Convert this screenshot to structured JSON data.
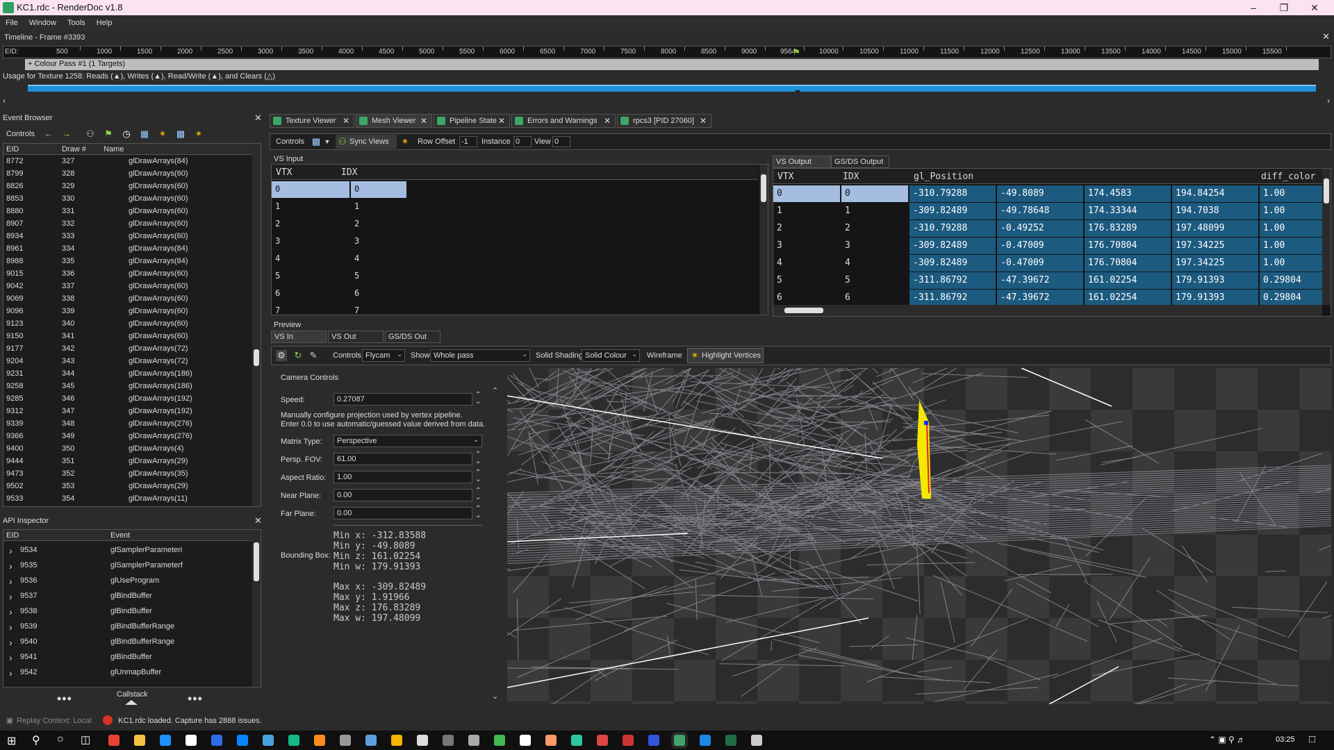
{
  "window": {
    "title": "KC1.rdc - RenderDoc v1.8"
  },
  "menu": [
    "File",
    "Window",
    "Tools",
    "Help"
  ],
  "timeline": {
    "title": "Timeline - Frame #3393",
    "eid_label": "EID:",
    "ticks": [
      "500",
      "1000",
      "1500",
      "2000",
      "2500",
      "3000",
      "3500",
      "4000",
      "4500",
      "5000",
      "5500",
      "6000",
      "6500",
      "7000",
      "7500",
      "8000",
      "8500",
      "9000",
      "9564",
      "10000",
      "10500",
      "11000",
      "11500",
      "12000",
      "12500",
      "13000",
      "13500",
      "14000",
      "14500",
      "15000",
      "15500"
    ],
    "colour_pass": "+ Colour Pass #1 (1 Targets)",
    "usage": "Usage for Texture 1258: Reads (▲), Writes (▲), Read/Write (▲), and Clears (△)"
  },
  "event_browser": {
    "title": "Event Browser",
    "controls_label": "Controls",
    "columns": [
      "EID",
      "Draw #",
      "Name"
    ],
    "rows": [
      [
        "8772",
        "327",
        "glDrawArrays(84)"
      ],
      [
        "8799",
        "328",
        "glDrawArrays(60)"
      ],
      [
        "8826",
        "329",
        "glDrawArrays(60)"
      ],
      [
        "8853",
        "330",
        "glDrawArrays(60)"
      ],
      [
        "8880",
        "331",
        "glDrawArrays(60)"
      ],
      [
        "8907",
        "332",
        "glDrawArrays(60)"
      ],
      [
        "8934",
        "333",
        "glDrawArrays(60)"
      ],
      [
        "8961",
        "334",
        "glDrawArrays(84)"
      ],
      [
        "8988",
        "335",
        "glDrawArrays(84)"
      ],
      [
        "9015",
        "336",
        "glDrawArrays(60)"
      ],
      [
        "9042",
        "337",
        "glDrawArrays(60)"
      ],
      [
        "9069",
        "338",
        "glDrawArrays(60)"
      ],
      [
        "9096",
        "339",
        "glDrawArrays(60)"
      ],
      [
        "9123",
        "340",
        "glDrawArrays(60)"
      ],
      [
        "9150",
        "341",
        "glDrawArrays(60)"
      ],
      [
        "9177",
        "342",
        "glDrawArrays(72)"
      ],
      [
        "9204",
        "343",
        "glDrawArrays(72)"
      ],
      [
        "9231",
        "344",
        "glDrawArrays(186)"
      ],
      [
        "9258",
        "345",
        "glDrawArrays(186)"
      ],
      [
        "9285",
        "346",
        "glDrawArrays(192)"
      ],
      [
        "9312",
        "347",
        "glDrawArrays(192)"
      ],
      [
        "9339",
        "348",
        "glDrawArrays(276)"
      ],
      [
        "9366",
        "349",
        "glDrawArrays(276)"
      ],
      [
        "9400",
        "350",
        "glDrawArrays(4)"
      ],
      [
        "9444",
        "351",
        "glDrawArrays(29)"
      ],
      [
        "9473",
        "352",
        "glDrawArrays(35)"
      ],
      [
        "9502",
        "353",
        "glDrawArrays(29)"
      ],
      [
        "9533",
        "354",
        "glDrawArrays(11)"
      ]
    ]
  },
  "api_inspector": {
    "title": "API Inspector",
    "columns": [
      "EID",
      "Event"
    ],
    "rows": [
      [
        "9534",
        "glSamplerParameteri"
      ],
      [
        "9535",
        "glSamplerParameterf"
      ],
      [
        "9536",
        "glUseProgram"
      ],
      [
        "9537",
        "glBindBuffer"
      ],
      [
        "9538",
        "glBindBuffer"
      ],
      [
        "9539",
        "glBindBufferRange"
      ],
      [
        "9540",
        "glBindBufferRange"
      ],
      [
        "9541",
        "glBindBuffer"
      ],
      [
        "9542",
        "glUnmapBuffer"
      ]
    ],
    "callstack": "Callstack"
  },
  "tabs": [
    {
      "label": "Texture Viewer"
    },
    {
      "label": "Mesh Viewer"
    },
    {
      "label": "Pipeline State"
    },
    {
      "label": "Errors and Warnings"
    },
    {
      "label": "rpcs3 [PID 27060]"
    }
  ],
  "mesh_toolbar": {
    "controls": "Controls",
    "sync_views": "Sync Views",
    "row_offset": "Row Offset",
    "row_offset_val": "-1",
    "instance": "Instance",
    "instance_val": "0",
    "view": "View",
    "view_val": "0"
  },
  "vs_input": {
    "title": "VS Input",
    "columns": [
      "VTX",
      "IDX"
    ],
    "rows": [
      [
        "0",
        "0"
      ],
      [
        "1",
        "1"
      ],
      [
        "2",
        "2"
      ],
      [
        "3",
        "3"
      ],
      [
        "4",
        "4"
      ],
      [
        "5",
        "5"
      ],
      [
        "6",
        "6"
      ],
      [
        "7",
        "7"
      ]
    ]
  },
  "vs_output": {
    "tabs": [
      "VS Output",
      "GS/DS Output"
    ],
    "columns": [
      "VTX",
      "IDX",
      "gl_Position",
      "diff_color"
    ],
    "rows": [
      [
        "0",
        "0",
        "-310.79288",
        "-49.8089",
        "174.4583",
        "194.84254",
        "1.00"
      ],
      [
        "1",
        "1",
        "-309.82489",
        "-49.78648",
        "174.33344",
        "194.7038",
        "1.00"
      ],
      [
        "2",
        "2",
        "-310.79288",
        "-0.49252",
        "176.83289",
        "197.48099",
        "1.00"
      ],
      [
        "3",
        "3",
        "-309.82489",
        "-0.47009",
        "176.70804",
        "197.34225",
        "1.00"
      ],
      [
        "4",
        "4",
        "-309.82489",
        "-0.47009",
        "176.70804",
        "197.34225",
        "1.00"
      ],
      [
        "5",
        "5",
        "-311.86792",
        "-47.39672",
        "161.02254",
        "179.91393",
        "0.29804"
      ],
      [
        "6",
        "6",
        "-311.86792",
        "-47.39672",
        "161.02254",
        "179.91393",
        "0.29804"
      ]
    ]
  },
  "preview": {
    "title": "Preview",
    "tabs": [
      "VS In",
      "VS Out",
      "GS/DS Out"
    ],
    "controls_label": "Controls",
    "controls_value": "Flycam",
    "show_label": "Show",
    "show_value": "Whole pass",
    "solid_label": "Solid Shading",
    "solid_value": "Solid Colour",
    "wireframe": "Wireframe",
    "highlight": "Highlight Vertices"
  },
  "camera": {
    "title": "Camera Controls",
    "speed_label": "Speed:",
    "speed": "0.27087",
    "note1": "Manually configure projection used by vertex pipeline.",
    "note2": "Enter 0.0 to use automatic/guessed value derived from data.",
    "matrix_label": "Matrix Type:",
    "matrix": "Perspective",
    "fov_label": "Persp. FOV:",
    "fov": "61.00",
    "aspect_label": "Aspect Ratio:",
    "aspect": "1.00",
    "near_label": "Near Plane:",
    "near": "0.00",
    "far_label": "Far Plane:",
    "far": "0.00",
    "bbox_label": "Bounding Box:",
    "bbox": [
      "Min x: -312.83588",
      "Min y: -49.8089",
      "Min z: 161.02254",
      "Min w: 179.91393",
      "Max x: -309.82489",
      "Max y: 1.91966",
      "Max z: 176.83289",
      "Max w: 197.48099"
    ]
  },
  "status": {
    "replay": "Replay Context: Local",
    "message": "KC1.rdc loaded. Capture has 2888 issues."
  },
  "taskbar": {
    "time": "03:25"
  }
}
